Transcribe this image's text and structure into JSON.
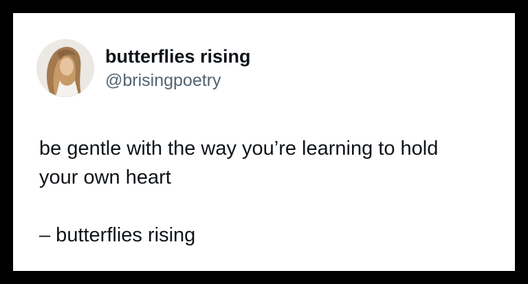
{
  "author": {
    "display_name": "butterflies rising",
    "handle": "@brisingpoetry"
  },
  "post": {
    "line1": "be gentle with the way you’re learning to hold",
    "line2": "your own heart",
    "signature": "– butterflies rising"
  },
  "colors": {
    "background_border": "#000000",
    "card": "#ffffff",
    "text_primary": "#0f1419",
    "text_secondary": "#536471"
  }
}
